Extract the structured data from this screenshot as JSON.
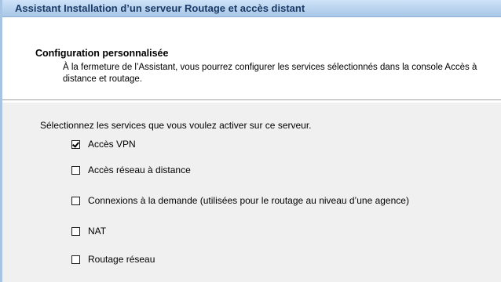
{
  "window": {
    "title": "Assistant Installation d’un serveur Routage et accès distant"
  },
  "header": {
    "title": "Configuration personnalisée",
    "description": "À la fermeture de l’Assistant, vous pourrez configurer les services sélectionnés dans la console Accès à distance et routage."
  },
  "body": {
    "instruction": "Sélectionnez les services que vous voulez activer sur ce serveur.",
    "options": [
      {
        "label": "Accès VPN",
        "checked": true
      },
      {
        "label": "Accès réseau à distance",
        "checked": false
      },
      {
        "label": "Connexions à la demande (utilisées pour le routage au niveau d’une agence)",
        "checked": false
      },
      {
        "label": "NAT",
        "checked": false
      },
      {
        "label": "Routage réseau",
        "checked": false
      }
    ]
  }
}
